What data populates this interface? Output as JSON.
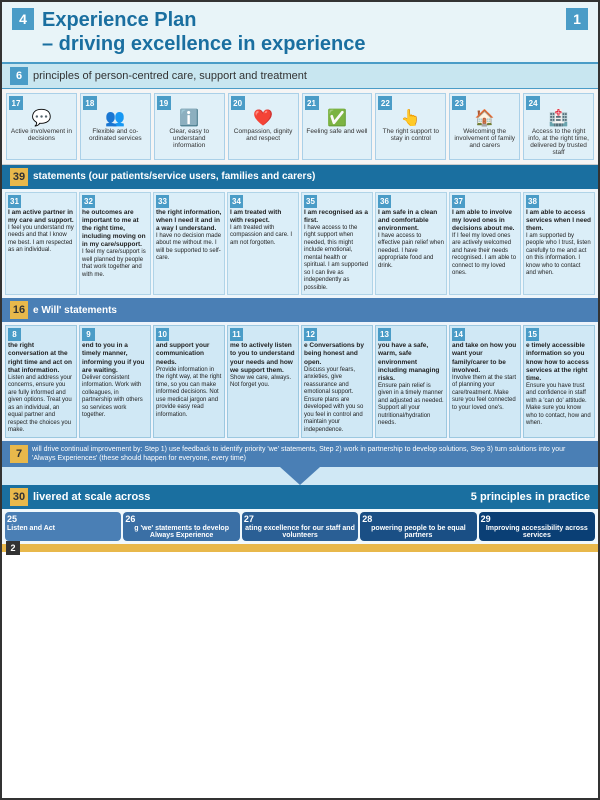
{
  "page": {
    "corner_num_top_left": "4",
    "corner_num_top_right": "1",
    "title_line1": "Experience Plan",
    "title_line2": "– driving excellence in experience",
    "principles_section": {
      "number": "6",
      "title": "principles of person-centred care, support and treatment",
      "items": [
        {
          "num": "17",
          "icon": "💬",
          "label": "Active involvement in decisions"
        },
        {
          "num": "18",
          "icon": "👥",
          "label": "Flexible and co-ordinated services"
        },
        {
          "num": "19",
          "icon": "ℹ️",
          "label": "Clear, easy to understand information"
        },
        {
          "num": "20",
          "icon": "❤️",
          "label": "Compassion, dignity and respect"
        },
        {
          "num": "21",
          "icon": "✅",
          "label": "Feeling safe and well"
        },
        {
          "num": "22",
          "icon": "👆",
          "label": "The right support to stay in control"
        },
        {
          "num": "23",
          "icon": "🏠",
          "label": "Welcoming the involvement of family and carers"
        },
        {
          "num": "24",
          "icon": "🏥",
          "label": "Access to the right info, at the right time, delivered by trusted staff"
        }
      ]
    },
    "statements_section": {
      "number": "39",
      "title": "statements (our patients/service users, families and carers)",
      "items": [
        {
          "num": "31",
          "bold": "I am active partner in my care and support.",
          "text": "I feel you understand my needs and that I know me best.\nI am respected as an individual."
        },
        {
          "num": "32",
          "bold": "he outcomes are important to me at the right time, including moving on in my care/support.",
          "text": "I feel my care/support is well planned by people that work together and with me."
        },
        {
          "num": "33",
          "bold": "the right information, when I need it and in a way I understand.",
          "text": "I have no decision made about me without me.\nI will be supported to self-care."
        },
        {
          "num": "34",
          "bold": "I am treated with with respect.",
          "text": "I am treated with compassion and care.\nI am not forgotten."
        },
        {
          "num": "35",
          "bold": "I am recognised as a first.",
          "text": "I have access to the right support when needed, this might include emotional, mental health or spiritual.\nI am supported so I can live as independently as possible."
        },
        {
          "num": "36",
          "bold": "I am safe in a clean and comfortable environment.",
          "text": "I have access to effective pain relief when needed.\nI have appropriate food and drink."
        },
        {
          "num": "37",
          "bold": "I am able to involve my loved ones in decisions about me.",
          "text": "If I feel my loved ones are actively welcomed and have their needs recognised.\nI am able to connect to my loved ones."
        },
        {
          "num": "38",
          "bold": "I am able to access services when I need them.",
          "text": "I am supported by people who I trust, listen carefully to me and act on this information.\nI know who to contact and when."
        }
      ]
    },
    "will_section": {
      "number": "16",
      "title": "e Will' statements",
      "items": [
        {
          "num": "8",
          "bold": "the right conversation at the right time and act on that information.",
          "text": "Listen and address your concerns, ensure you are fully informed and given options.\nTreat you as an individual, an equal partner and respect the choices you make."
        },
        {
          "num": "9",
          "bold": "end to you in a timely manner, informing you if you are waiting.",
          "text": "Deliver consistent information.\nWork with colleagues, in partnership with others so services work together."
        },
        {
          "num": "10",
          "bold": "and support your communication needs.",
          "text": "Provide information in the right way, at the right time, so you can make informed decisions.\nNot use medical jargon and provide easy read information."
        },
        {
          "num": "11",
          "bold": "me to actively listen to you to understand your needs and how we support them.",
          "text": "Show we care, always.\nNot forget you."
        },
        {
          "num": "12",
          "bold": "e Conversations by being honest and open.",
          "text": "Discuss your fears, anxieties, give reassurance and emotional support.\nEnsure plans are developed with you so you feel in control and maintain your independence."
        },
        {
          "num": "13",
          "bold": "you have a safe, warm, safe environment including managing risks.",
          "text": "Ensure pain relief is given in a timely manner and adjusted as needed.\nSupport all your nutritional/hydration needs."
        },
        {
          "num": "14",
          "bold": "and take on how you want your family/carer to be involved.",
          "text": "Involve them at the start of planning your care/treatment.\nMake sure you feel connected to your loved one's."
        },
        {
          "num": "15",
          "bold": "e timely accessible information so you know how to access services at the right time.",
          "text": "Ensure you have trust and confidence in staff with a 'can do' attitude.\nMake sure you know who to contact, how and when."
        }
      ]
    },
    "improvement_section": {
      "number": "7",
      "text": "will drive continual improvement by: Step 1) use feedback to identify priority 'we' statements, Step 2) work in partnership to develop solutions, Step 3) turn solutions into your 'Always Experiences' (these should happen for everyone, every time)"
    },
    "delivered_section": {
      "number": "30",
      "title_left": "livered at scale across",
      "title_right": "5 principles in practice",
      "items": [
        {
          "num": "25",
          "label": "Listen and Act",
          "color": "#4a7fb5"
        },
        {
          "num": "26",
          "label": "g 'we' statements to develop Always Experience",
          "color": "#3a6fa5"
        },
        {
          "num": "27",
          "label": "ating excellence for our staff and volunteers",
          "color": "#2a5f95"
        },
        {
          "num": "28",
          "label": "powering people to be equal partners",
          "color": "#1a4f85"
        },
        {
          "num": "29",
          "label": "Improving accessibility across services",
          "color": "#0a3f75"
        }
      ]
    },
    "footer": {
      "number": "2"
    }
  }
}
